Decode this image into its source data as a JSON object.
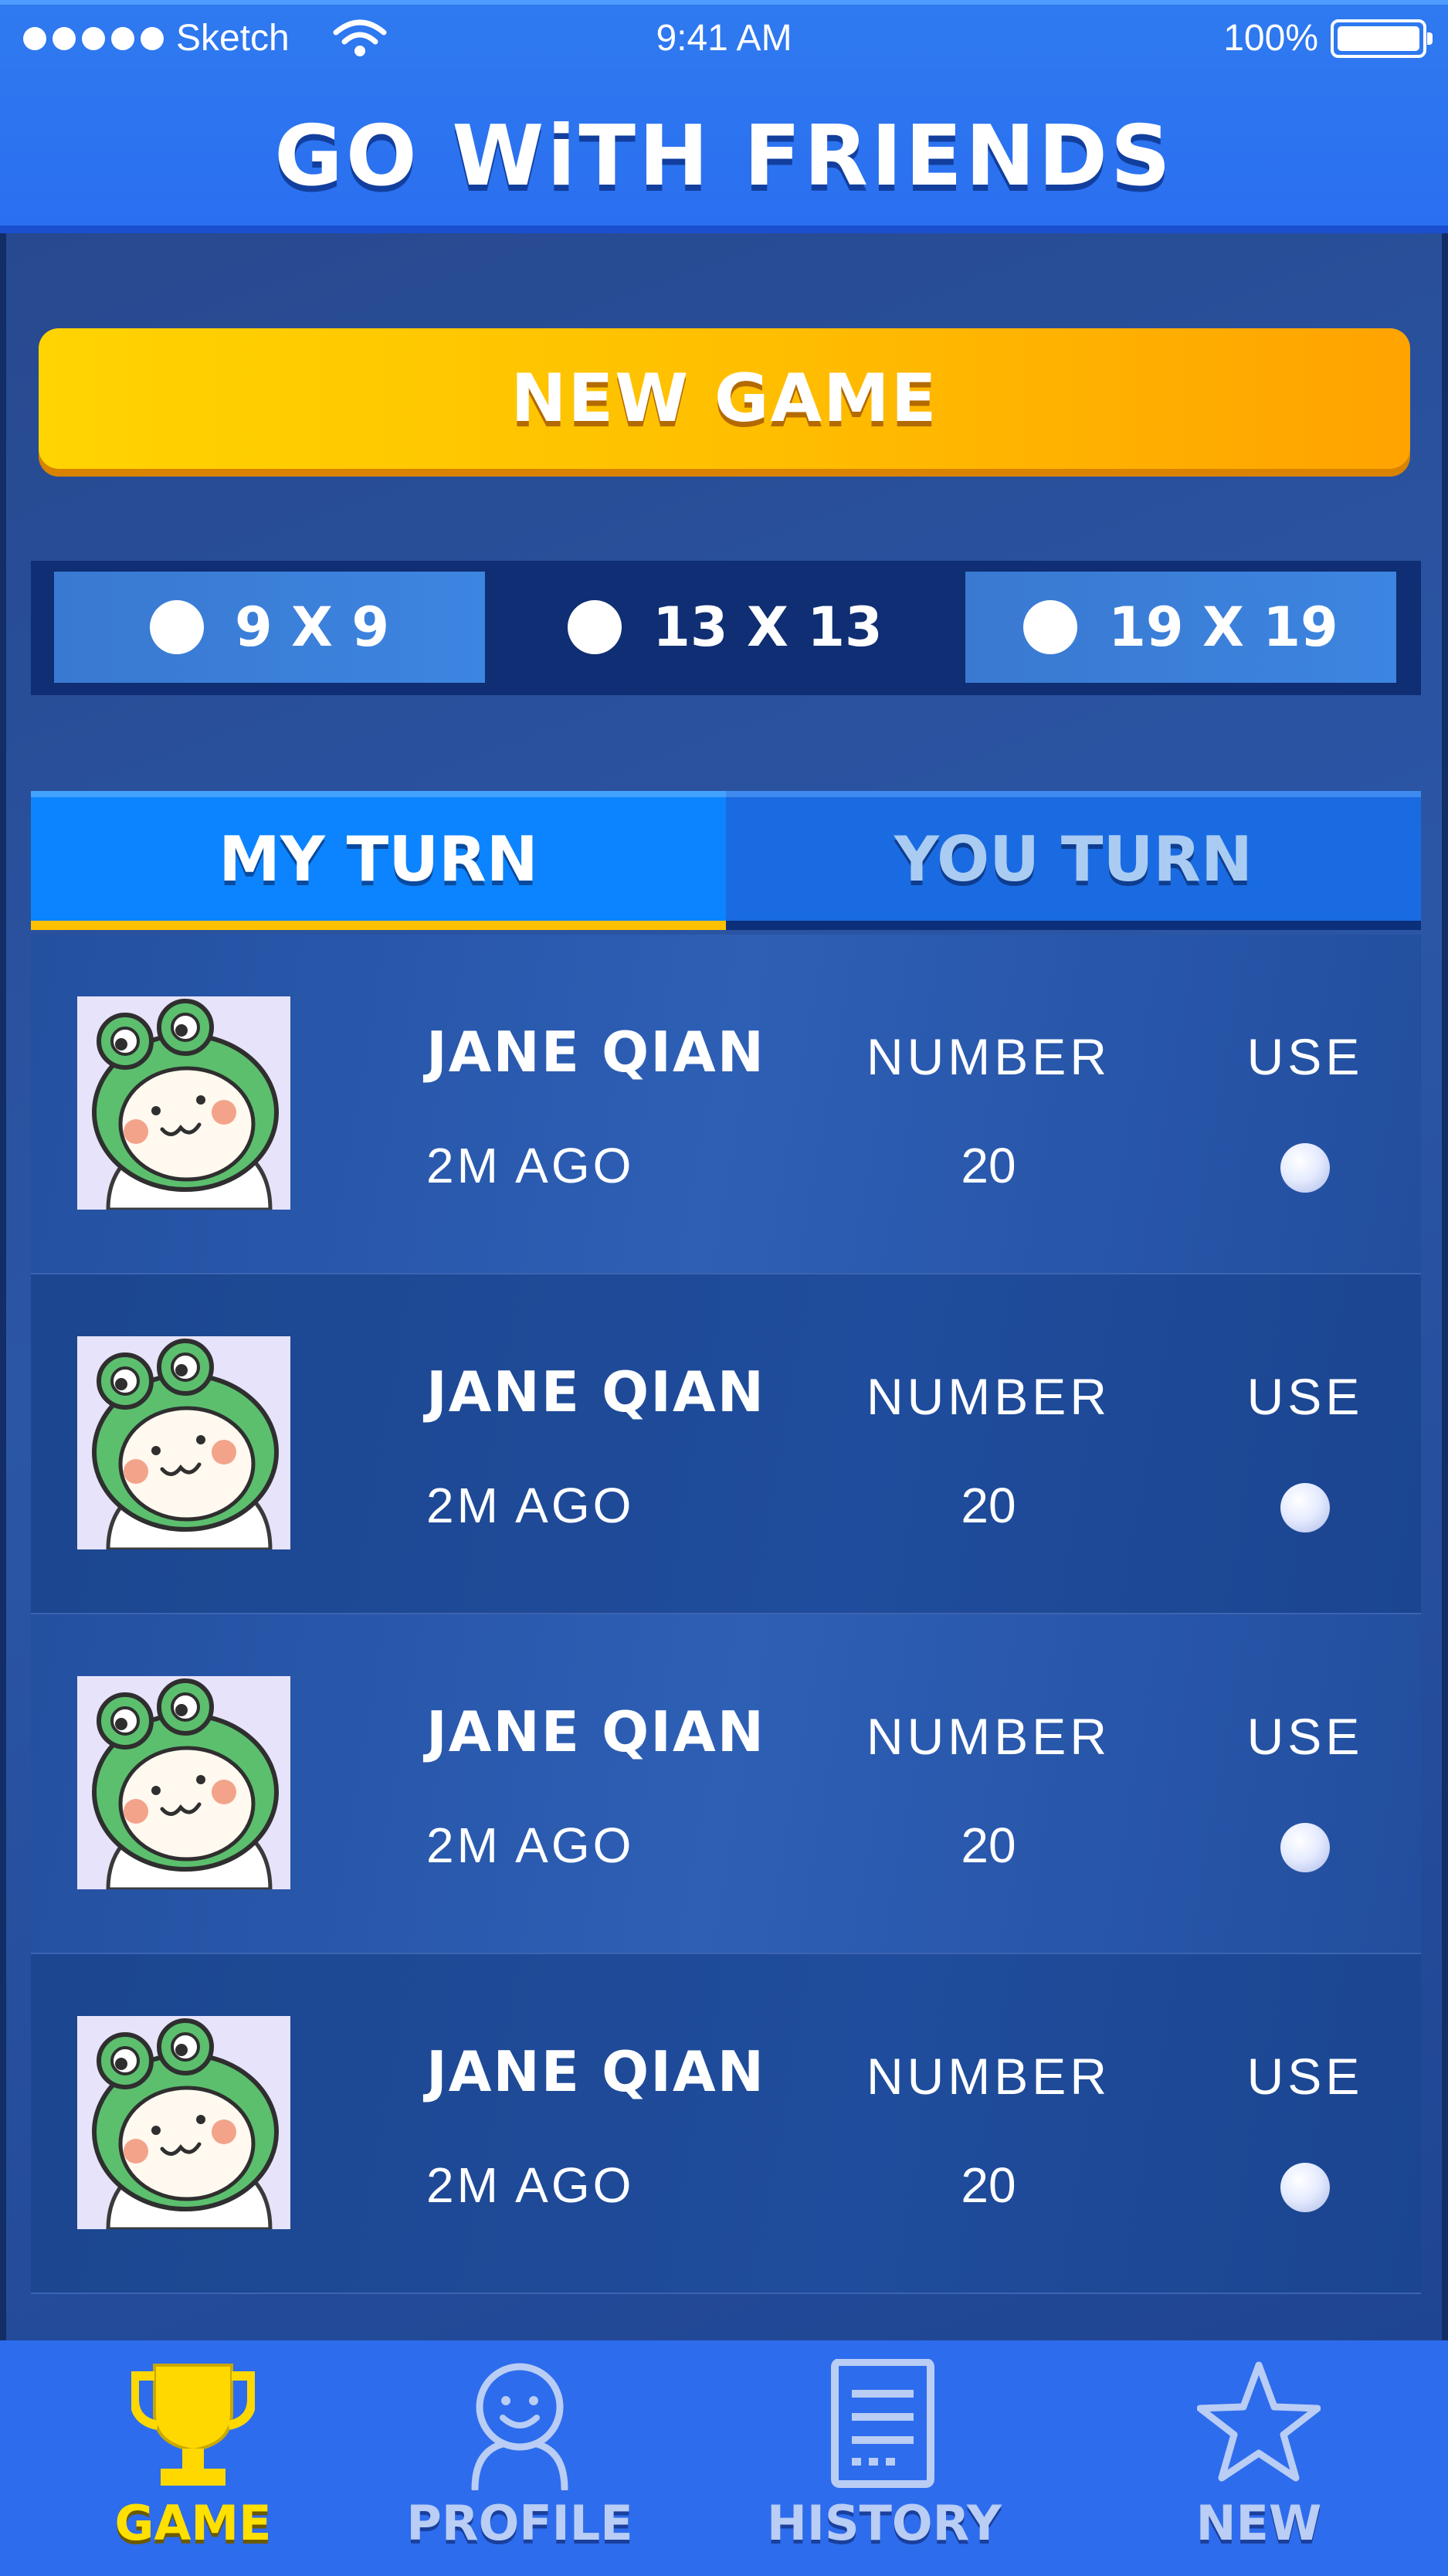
{
  "status_bar": {
    "carrier": "Sketch",
    "time": "9:41 AM",
    "battery": "100%"
  },
  "header": {
    "title": "GO WiTH FRIENDS"
  },
  "new_game": {
    "label": "NEW GAME"
  },
  "board_sizes": [
    {
      "label": "9 X 9",
      "selected": true
    },
    {
      "label": "13 X 13",
      "selected": false
    },
    {
      "label": "19 X 19",
      "selected": true
    }
  ],
  "turn_tabs": {
    "my_turn": "MY TURN",
    "you_turn": "YOU TURN"
  },
  "games": [
    {
      "name": "JANE QIAN",
      "ago": "2M AGO",
      "number_label": "NUMBER",
      "number": "20",
      "use_label": "USE"
    },
    {
      "name": "JANE QIAN",
      "ago": "2M AGO",
      "number_label": "NUMBER",
      "number": "20",
      "use_label": "USE"
    },
    {
      "name": "JANE QIAN",
      "ago": "2M AGO",
      "number_label": "NUMBER",
      "number": "20",
      "use_label": "USE"
    },
    {
      "name": "JANE QIAN",
      "ago": "2M AGO",
      "number_label": "NUMBER",
      "number": "20",
      "use_label": "USE"
    }
  ],
  "tabbar": [
    {
      "label": "GAME",
      "icon": "trophy-icon",
      "selected": true
    },
    {
      "label": "PROFILE",
      "icon": "profile-icon",
      "selected": false
    },
    {
      "label": "HISTORY",
      "icon": "history-icon",
      "selected": false
    },
    {
      "label": "NEW",
      "icon": "star-icon",
      "selected": false
    }
  ],
  "colors": {
    "accent_yellow": "#ffc000",
    "primary_blue": "#2d6cec",
    "tab_active": "#0c84ff"
  }
}
